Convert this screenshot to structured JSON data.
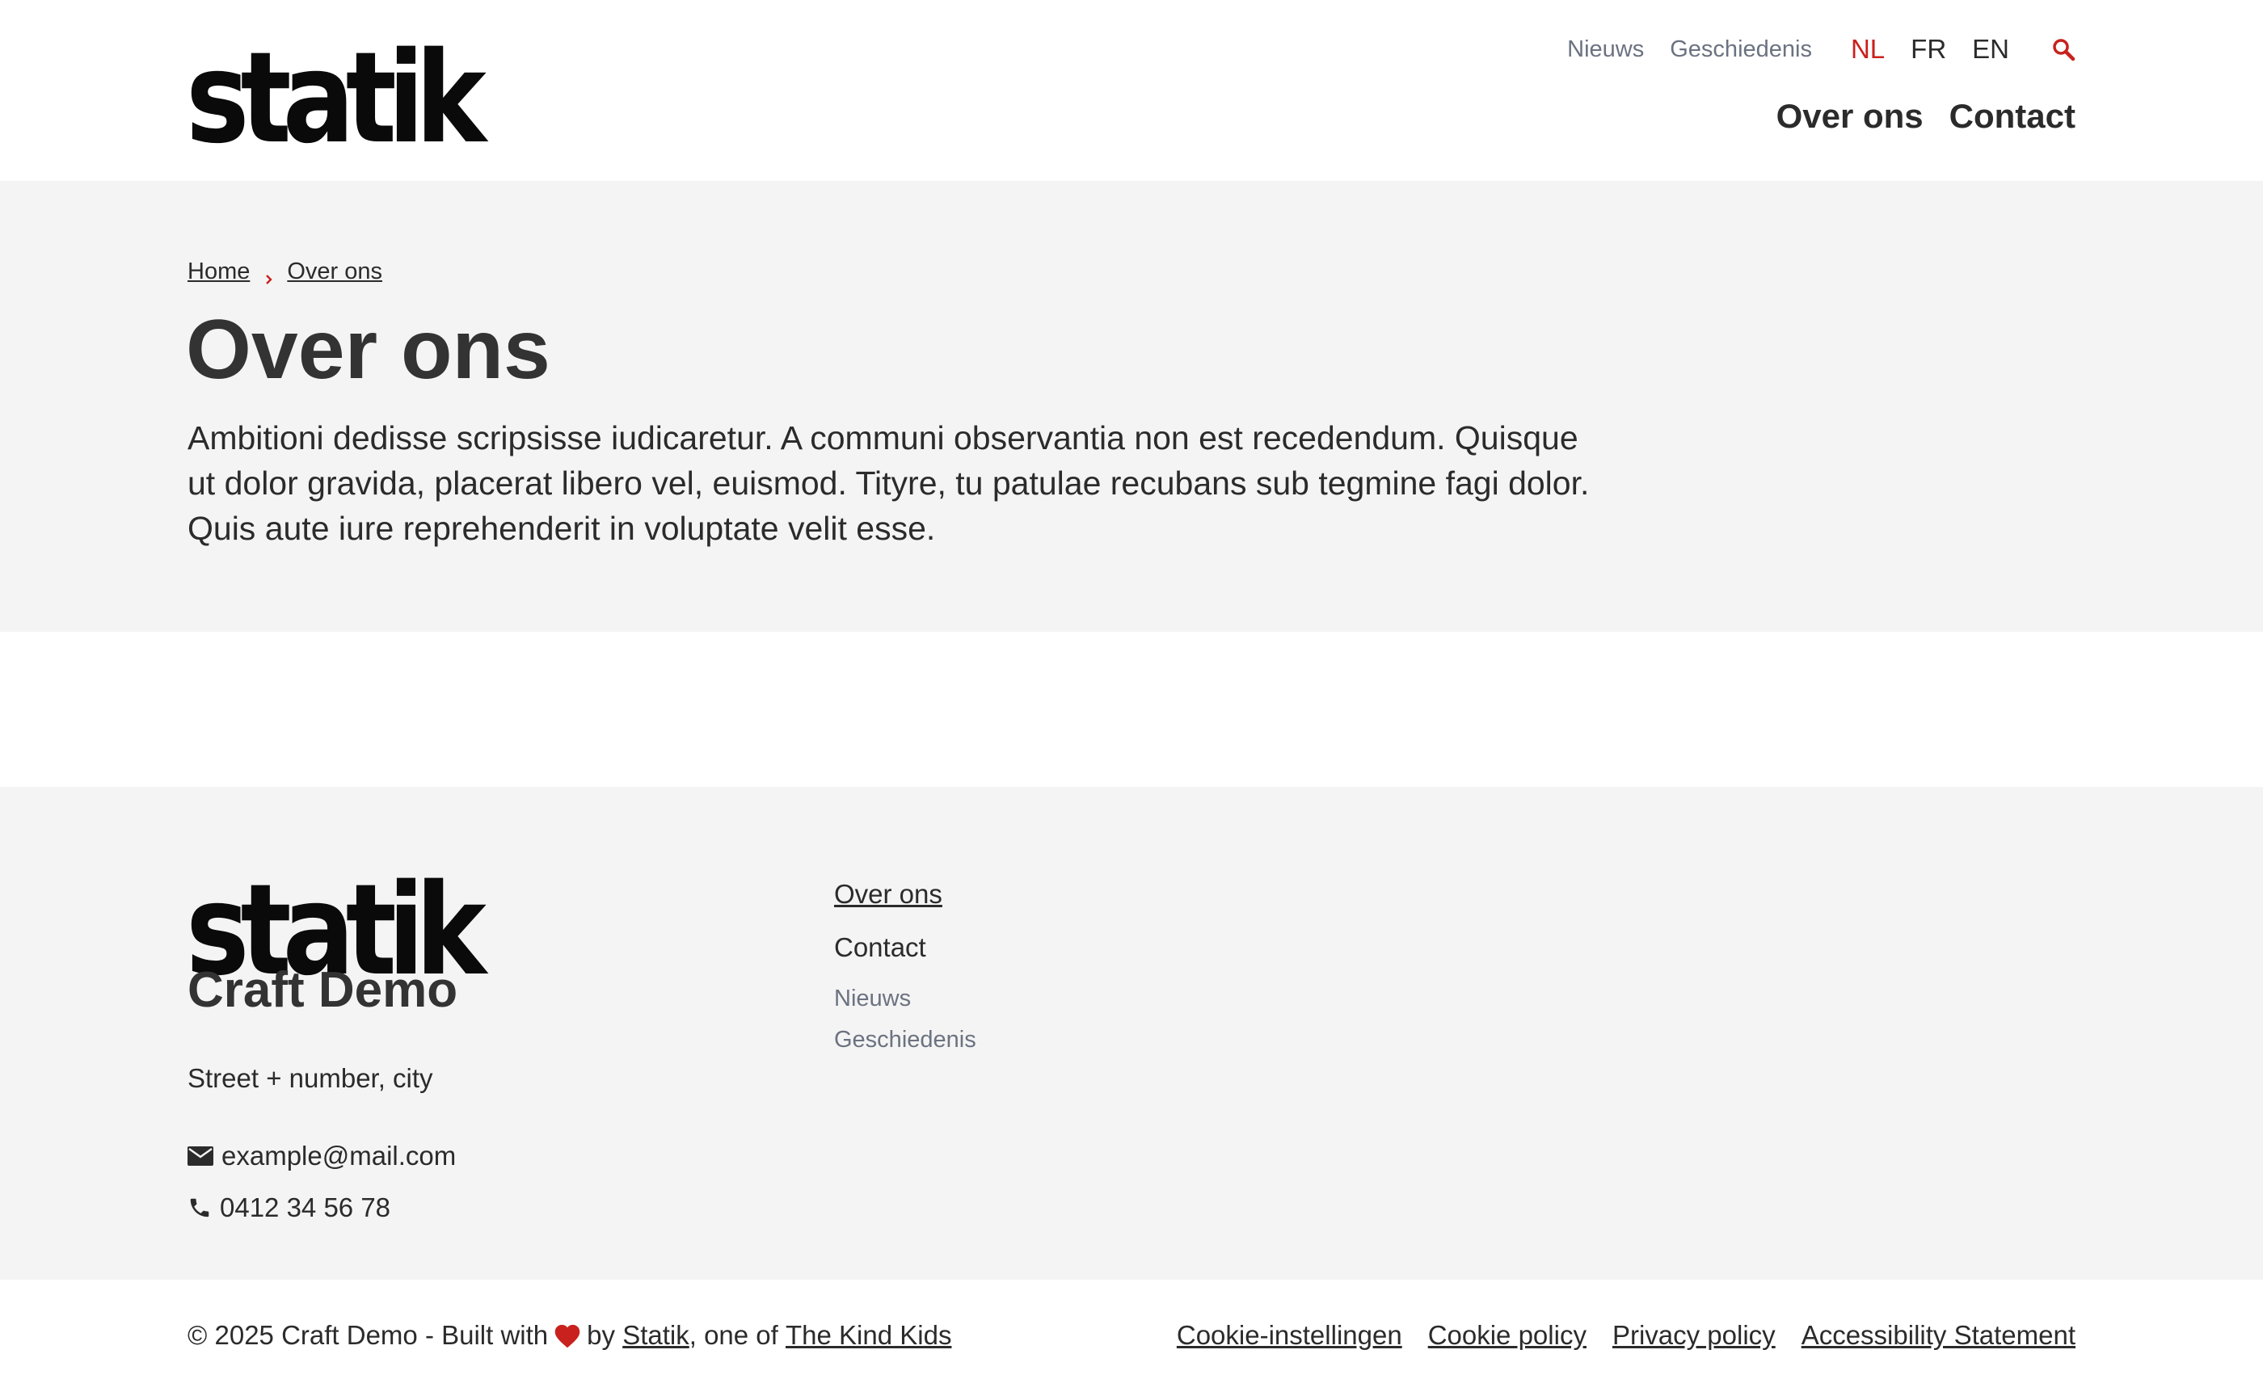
{
  "header": {
    "logo_text": "statik",
    "top_links": [
      "Nieuws",
      "Geschiedenis"
    ],
    "languages": [
      {
        "code": "NL",
        "active": true
      },
      {
        "code": "FR",
        "active": false
      },
      {
        "code": "EN",
        "active": false
      }
    ],
    "search_icon": "search-icon",
    "main_nav": [
      "Over ons",
      "Contact"
    ]
  },
  "hero": {
    "breadcrumb": [
      "Home",
      "Over ons"
    ],
    "breadcrumb_separator_icon": "chevron-right-icon",
    "title": "Over ons",
    "intro": "Ambitioni dedisse scripsisse iudicaretur. A communi observantia non est recedendum. Quisque ut dolor gravida, placerat libero vel, euismod. Tityre, tu patulae recubans sub tegmine fagi dolor. Quis aute iure reprehenderit in voluptate velit esse."
  },
  "footer": {
    "logo_text": "statik",
    "brand_name": "Craft Demo",
    "address": "Street + number, city",
    "email": "example@mail.com",
    "email_icon": "mail-icon",
    "phone": "0412 34 56 78",
    "phone_icon": "phone-icon",
    "nav_primary": [
      "Over ons",
      "Contact"
    ],
    "nav_secondary": [
      "Nieuws",
      "Geschiedenis"
    ]
  },
  "bottom": {
    "copyright_prefix": "© 2025 Craft Demo - Built with",
    "heart_icon": "heart-icon",
    "by": "by",
    "statik_link": "Statik",
    "one_of": ", one of",
    "kind_kids_link": "The Kind Kids",
    "legal_links": [
      "Cookie-instellingen",
      "Cookie policy",
      "Privacy policy",
      "Accessibility Statement"
    ]
  },
  "colors": {
    "accent": "#c8211e",
    "text": "#2b2b2b",
    "muted": "#6b7280",
    "panel_bg": "#f4f4f4"
  }
}
